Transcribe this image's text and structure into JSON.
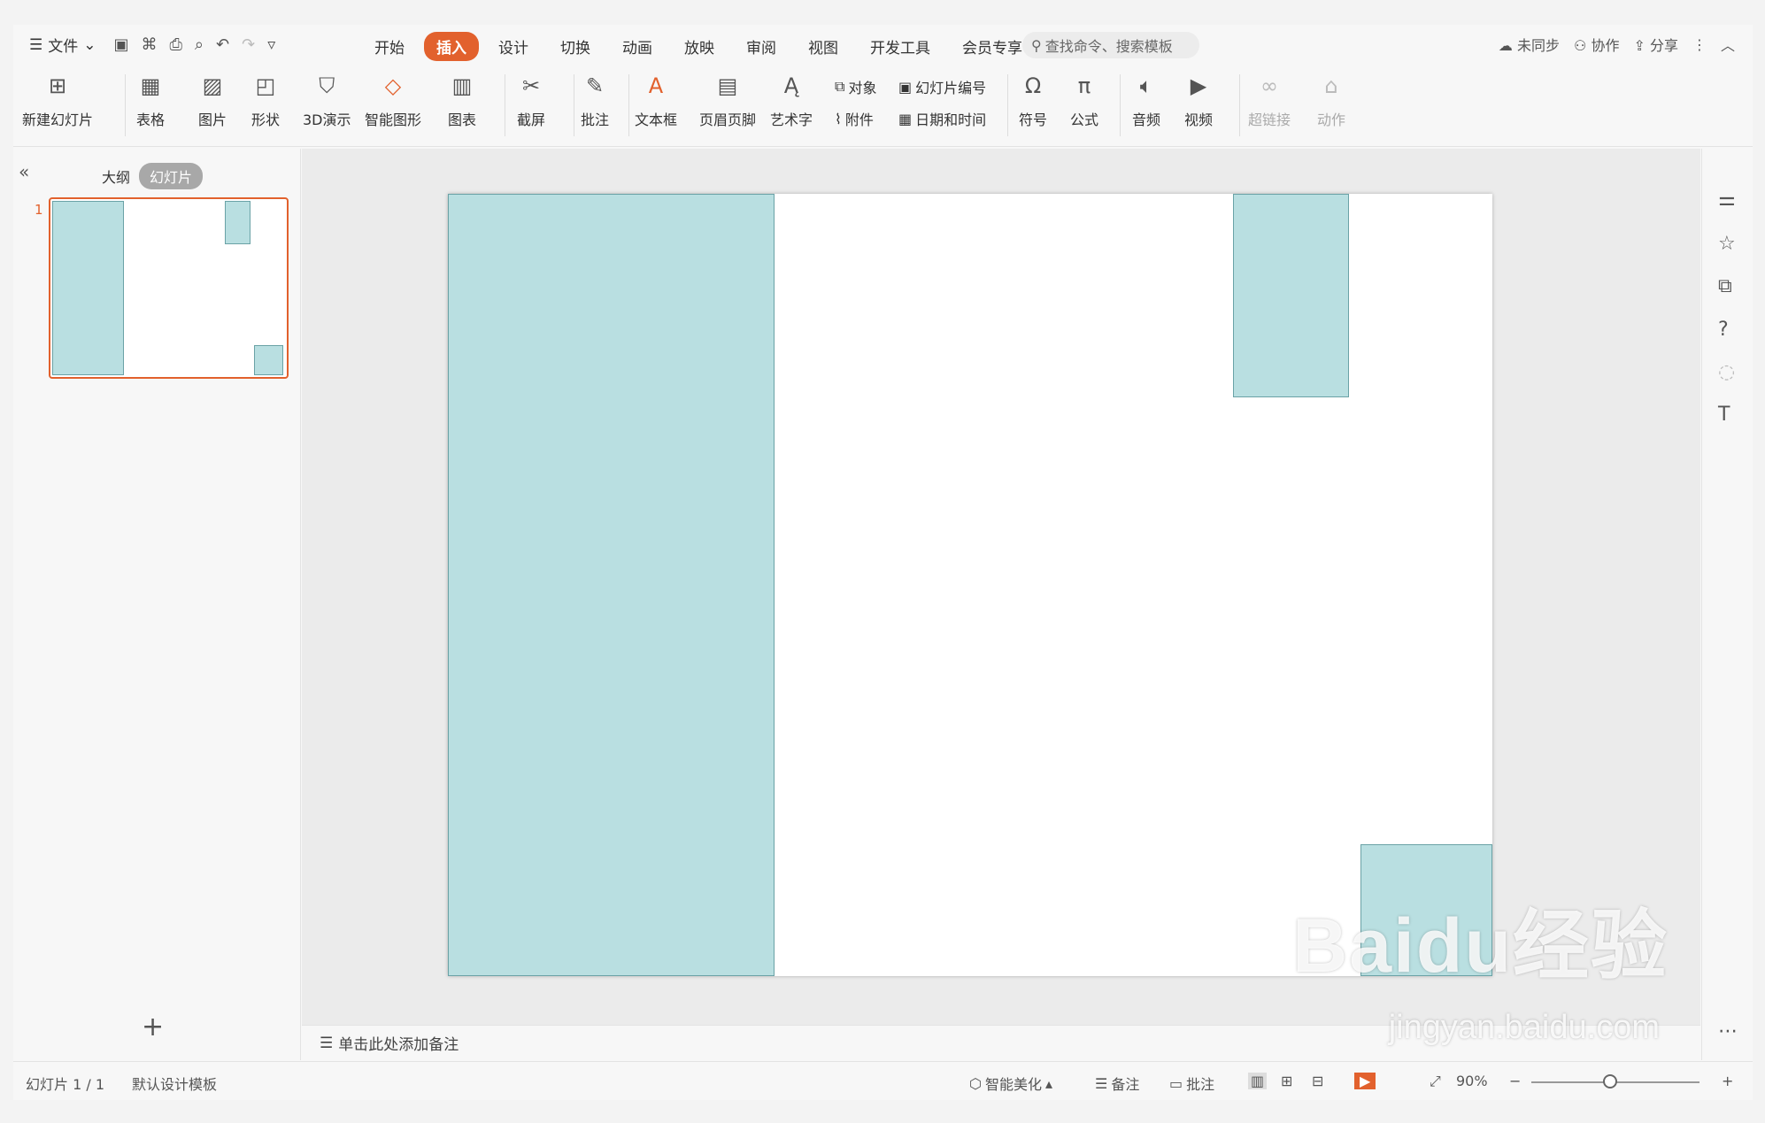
{
  "menu": {
    "file_label": "文件",
    "tabs": [
      "开始",
      "插入",
      "设计",
      "切换",
      "动画",
      "放映",
      "审阅",
      "视图",
      "开发工具",
      "会员专享"
    ],
    "active_tab": "插入",
    "search_placeholder": "查找命令、搜索模板",
    "right": {
      "sync": "未同步",
      "collab": "协作",
      "share": "分享"
    }
  },
  "ribbon": {
    "new_slide": "新建幻灯片",
    "table": "表格",
    "picture": "图片",
    "shape": "形状",
    "three_d": "3D演示",
    "smart_shape": "智能图形",
    "chart": "图表",
    "screenshot": "截屏",
    "comment": "批注",
    "textbox": "文本框",
    "header_footer": "页眉页脚",
    "wordart": "艺术字",
    "object": "对象",
    "attachment": "附件",
    "slide_number": "幻灯片编号",
    "date_time": "日期和时间",
    "symbol": "符号",
    "formula": "公式",
    "audio": "音频",
    "video": "视频",
    "hyperlink": "超链接",
    "action": "动作"
  },
  "left_pane": {
    "tab_outline": "大纲",
    "tab_slides": "幻灯片",
    "slide_number": "1"
  },
  "notes_placeholder": "单击此处添加备注",
  "status": {
    "slide_info": "幻灯片 1 / 1",
    "template": "默认设计模板",
    "beautify": "智能美化",
    "notes": "备注",
    "comments": "批注",
    "zoom": "90%"
  },
  "watermark": {
    "brand": "Baidu经验",
    "url": "jingyan.baidu.com"
  },
  "colors": {
    "accent": "#e2612d",
    "shape_fill": "#b9dfe1",
    "shape_border": "#6aa2a6"
  }
}
